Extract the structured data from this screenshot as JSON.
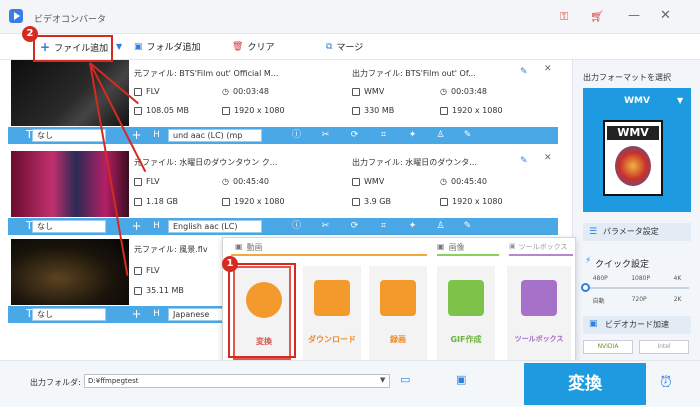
{
  "app": {
    "title": "ビデオコンバータ"
  },
  "toolbar": {
    "add_file": "ファイル追加",
    "add_folder": "フォルダ追加",
    "clear": "クリア",
    "merge": "マージ"
  },
  "files": [
    {
      "src": "元ファイル: BTS'Film out' Official M...",
      "src_format": "FLV",
      "src_duration": "00:03:48",
      "src_size": "108.05 MB",
      "src_res": "1920 x 1080",
      "out": "出力ファイル: BTS'Film out' Of...",
      "out_format": "WMV",
      "out_duration": "00:03:48",
      "out_size": "330 MB",
      "out_res": "1920 x 1080",
      "subtitle": "なし",
      "audio": "und aac (LC) (mp"
    },
    {
      "src": "元ファイル: 水曜日のダウンタウン ク...",
      "src_format": "FLV",
      "src_duration": "00:45:40",
      "src_size": "1.18 GB",
      "src_res": "1920 x 1080",
      "out": "出力ファイル: 水曜日のダウンタ...",
      "out_format": "WMV",
      "out_duration": "00:45:40",
      "out_size": "3.9 GB",
      "out_res": "1920 x 1080",
      "subtitle": "なし",
      "audio": "English aac (LC)"
    },
    {
      "src": "元ファイル: 風景.flv",
      "src_format": "FLV",
      "src_size": "35.11 MB",
      "subtitle": "なし",
      "audio": "Japanese"
    }
  ],
  "popup": {
    "tab_video": "動画",
    "tab_image": "画像",
    "tab_tools": "ツールボックス",
    "cards": [
      "変換",
      "ダウンロード",
      "録画",
      "GIF作成",
      "ツールボックス"
    ]
  },
  "right": {
    "select_format": "出力フォーマットを選択",
    "format": "WMV",
    "params": "パラメータ設定",
    "quick": "クイック設定",
    "res_top": [
      "480P",
      "1080P",
      "4K"
    ],
    "res_bottom": [
      "自動",
      "720P",
      "2K"
    ],
    "gpu": "ビデオカード加速",
    "nvidia": "NVIDIA",
    "intel": "Intel"
  },
  "bottom": {
    "folder_label": "出力フォルダ:",
    "folder_path": "D:¥ffmpegtest",
    "convert": "変換"
  },
  "badges": {
    "one": "1",
    "two": "2"
  }
}
